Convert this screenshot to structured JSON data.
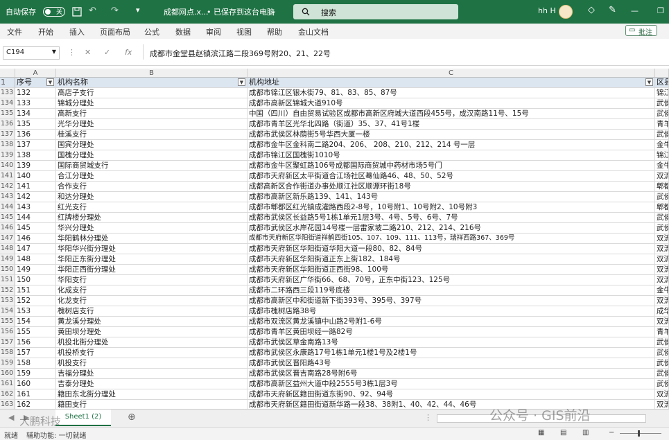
{
  "titlebar": {
    "autosave": "自动保存",
    "toggle": "关",
    "file_title": "成都网点.x...",
    "save_status": "• 已保存到这台电脑",
    "search_placeholder": "搜索",
    "user": "hh H"
  },
  "menu": [
    "文件",
    "开始",
    "插入",
    "页面布局",
    "公式",
    "数据",
    "审阅",
    "视图",
    "帮助",
    "金山文档"
  ],
  "comment_button": "批注",
  "formula": {
    "name_box": "C194",
    "fx": "fx",
    "content": "成都市金堂县赵镇滨江路二段369号附20、21、22号"
  },
  "columns": [
    "A",
    "B",
    "C"
  ],
  "header_row": {
    "num": "1",
    "a": "序号",
    "b": "机构名称",
    "c": "机构地址",
    "d": "区县"
  },
  "rows": [
    {
      "n": "133",
      "a": "132",
      "b": "高店子支行",
      "c": "成都市锦江区银木街79、81、83、85、87号",
      "d": "锦江"
    },
    {
      "n": "134",
      "a": "133",
      "b": "锦城分理处",
      "c": "成都市高新区锦城大道910号",
      "d": "武侯"
    },
    {
      "n": "135",
      "a": "134",
      "b": "高新支行",
      "c": "中国（四川）自由贸易试验区成都市高新区府城大道西段455号，成汉南路11号、15号",
      "d": "武侯"
    },
    {
      "n": "136",
      "a": "135",
      "b": "光华分理处",
      "c": "成都市青羊区光华北四路（街道）35、37、41号1楼",
      "d": "青羊"
    },
    {
      "n": "137",
      "a": "136",
      "b": "桂溪支行",
      "c": "成都市武侯区林荫街5号华西大厦一楼",
      "d": "武侯"
    },
    {
      "n": "138",
      "a": "137",
      "b": "国宾分理处",
      "c": "成都市金牛区金科南二路204、206、 208、210、212、214 号一层",
      "d": "金牛"
    },
    {
      "n": "139",
      "a": "138",
      "b": "国槐分理处",
      "c": "成都市锦江区国槐街1010号",
      "d": "锦江"
    },
    {
      "n": "140",
      "a": "139",
      "b": "国际商贸城支行",
      "c": "成都市金牛区聚虹路106号成都国际商贸城中药材市场5号门",
      "d": "金牛"
    },
    {
      "n": "141",
      "a": "140",
      "b": "合江分理处",
      "c": "成都市天府新区太平街道合江场社区蓦仙路46、48、50、52号",
      "d": "双流"
    },
    {
      "n": "142",
      "a": "141",
      "b": "合作支行",
      "c": "成都高新区合作街道办事处顺江社区顺源环街18号",
      "d": "郫都"
    },
    {
      "n": "143",
      "a": "142",
      "b": "和达分理处",
      "c": "成都市高新区新乐路139、141、143号",
      "d": "武侯"
    },
    {
      "n": "144",
      "a": "143",
      "b": "红光支行",
      "c": "成都市郫都区红光镇成灌路西段2-8号，10号附1、10号附2、10号附3",
      "d": "郫都"
    },
    {
      "n": "145",
      "a": "144",
      "b": "红牌楼分理处",
      "c": "成都市武侯区长益路5号1栋1单元1层3号、4号、5号、6号、7号",
      "d": "武侯"
    },
    {
      "n": "146",
      "a": "145",
      "b": "华兴分理处",
      "c": "成都市武侯区水岸花园14号楼一层雷家坡二路210、212、214、216号",
      "d": "武侯"
    },
    {
      "n": "147",
      "a": "146",
      "b": "华阳鹤林分理处",
      "c": "成都市天府新区华阳街道祥鹤四街105、107、109、111、113号，瑞祥西路367、369号",
      "d": "双流"
    },
    {
      "n": "148",
      "a": "147",
      "b": "华阳华兴街分理处",
      "c": "成都市天府新区华阳街道华阳大道一段80、82、84号",
      "d": "双流"
    },
    {
      "n": "149",
      "a": "148",
      "b": "华阳正东街分理处",
      "c": "成都市天府新区华阳街道正东上街182、184号",
      "d": "双流"
    },
    {
      "n": "150",
      "a": "149",
      "b": "华阳正西街分理处",
      "c": "成都市天府新区华阳街道正西街98、100号",
      "d": "双流"
    },
    {
      "n": "151",
      "a": "150",
      "b": "华阳支行",
      "c": "成都市天府新区广华街66、68、70号，正东中街123、125号",
      "d": "双流"
    },
    {
      "n": "152",
      "a": "151",
      "b": "化成支行",
      "c": "成都市二环路西三段119号底楼",
      "d": "金牛"
    },
    {
      "n": "153",
      "a": "152",
      "b": "化龙支行",
      "c": "成都市高新区中和街道新下街393号、395号、397号",
      "d": "双流"
    },
    {
      "n": "154",
      "a": "153",
      "b": "槐树店支行",
      "c": "成都市槐树店路38号",
      "d": "成华"
    },
    {
      "n": "155",
      "a": "154",
      "b": "黄龙溪分理处",
      "c": "成都市双流区黄龙溪镇中山路2号附1-6号",
      "d": "双流"
    },
    {
      "n": "156",
      "a": "155",
      "b": "黄田坝分理处",
      "c": "成都市青羊区黄田坝经一路82号",
      "d": "青羊"
    },
    {
      "n": "157",
      "a": "156",
      "b": "机投北街分理处",
      "c": "成都市武侯区草金南路13号",
      "d": "武侯"
    },
    {
      "n": "158",
      "a": "157",
      "b": "机投桥支行",
      "c": "成都市武侯区永康路17号1栋1单元1楼1号及2楼1号",
      "d": "武侯"
    },
    {
      "n": "159",
      "a": "158",
      "b": "机投支行",
      "c": "成都市武侯区晋阳路43号",
      "d": "武侯"
    },
    {
      "n": "160",
      "a": "159",
      "b": "吉福分理处",
      "c": "成都市武侯区晋吉南路28号附6号",
      "d": "武侯"
    },
    {
      "n": "161",
      "a": "160",
      "b": "吉泰分理处",
      "c": "成都市高新区益州大道中段2555号3栋1层3号",
      "d": "武侯"
    },
    {
      "n": "162",
      "a": "161",
      "b": "籍田东北街分理处",
      "c": "成都市天府新区籍田街道东街90、92、94号",
      "d": "双流"
    },
    {
      "n": "163",
      "a": "162",
      "b": "籍田支行",
      "c": "成都市天府新区籍田街道新华路一段38、38附1、40、42、44、46号",
      "d": "双流"
    }
  ],
  "sheet_tab": "Sheet1 (2)",
  "status": {
    "mode": "就绪",
    "accessibility": "辅助功能: 一切就绪"
  },
  "watermarks": {
    "wechat": "公众号 · GIS前沿",
    "left": "大鹏科技"
  }
}
